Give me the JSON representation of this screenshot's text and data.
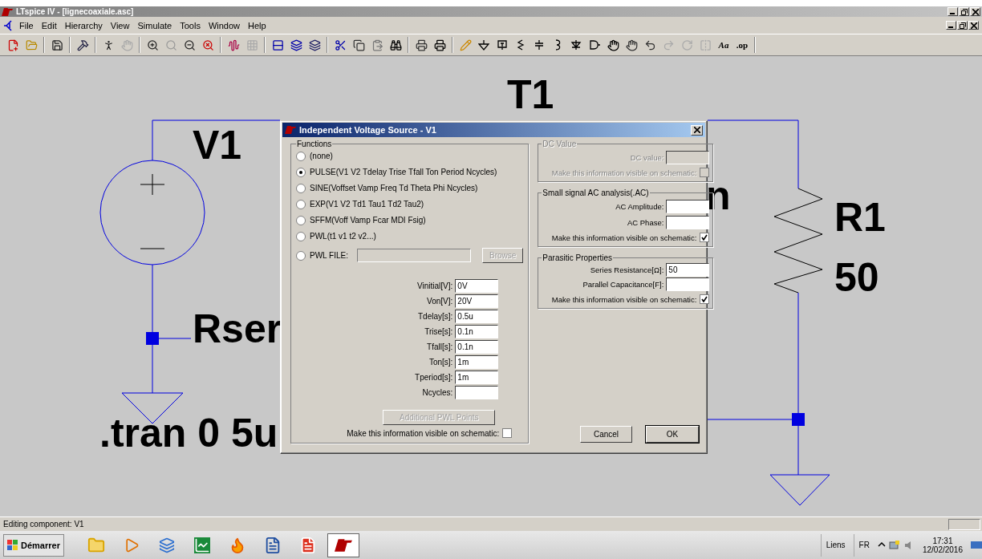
{
  "window": {
    "title": "LTspice IV - [lignecoaxiale.asc]"
  },
  "menu": [
    "File",
    "Edit",
    "Hierarchy",
    "View",
    "Simulate",
    "Tools",
    "Window",
    "Help"
  ],
  "toolbar": {
    "text_buttons": [
      "Aa",
      ".op"
    ]
  },
  "schematic": {
    "labels": [
      "T1",
      "V1",
      "n",
      "R1",
      "50",
      "Rser",
      ".tran 0 5u"
    ]
  },
  "dialog": {
    "title": "Independent Voltage Source - V1",
    "functions": {
      "title": "Functions",
      "options": [
        {
          "label": "(none)",
          "selected": false
        },
        {
          "label": "PULSE(V1 V2 Tdelay Trise Tfall Ton Period Ncycles)",
          "selected": true
        },
        {
          "label": "SINE(Voffset Vamp Freq Td Theta Phi Ncycles)",
          "selected": false
        },
        {
          "label": "EXP(V1 V2 Td1 Tau1 Td2 Tau2)",
          "selected": false
        },
        {
          "label": "SFFM(Voff Vamp Fcar MDI Fsig)",
          "selected": false
        },
        {
          "label": "PWL(t1 v1 t2 v2...)",
          "selected": false
        },
        {
          "label": "PWL FILE:",
          "selected": false
        }
      ],
      "browse": {
        "label": "Browse",
        "disabled": true
      },
      "parameters": [
        {
          "label": "Vinitial[V]:",
          "value": "0V"
        },
        {
          "label": "Von[V]:",
          "value": "20V"
        },
        {
          "label": "Tdelay[s]:",
          "value": "0.5u"
        },
        {
          "label": "Trise[s]:",
          "value": "0.1n"
        },
        {
          "label": "Tfall[s]:",
          "value": "0.1n"
        },
        {
          "label": "Ton[s]:",
          "value": "1m"
        },
        {
          "label": "Tperiod[s]:",
          "value": "1m"
        },
        {
          "label": "Ncycles:"
        }
      ],
      "additional_button": {
        "label": "Additional PWL Points",
        "disabled": true
      },
      "visible": {
        "label": "Make this information visible on schematic:",
        "checked": false
      }
    },
    "groups": [
      {
        "title": "DC Value",
        "disabled": true,
        "fields": [
          {
            "label": "DC value:"
          }
        ],
        "visible": {
          "label": "Make this information visible on schematic:",
          "checked": false
        }
      },
      {
        "title": "Small signal AC analysis(.AC)",
        "disabled": false,
        "fields": [
          {
            "label": "AC Amplitude:"
          },
          {
            "label": "AC Phase:"
          }
        ],
        "visible": {
          "label": "Make this information visible on schematic:",
          "checked": true
        }
      },
      {
        "title": "Parasitic Properties",
        "disabled": false,
        "fields": [
          {
            "label": "Series Resistance[Ω]:",
            "value": "50"
          },
          {
            "label": "Parallel Capacitance[F]:"
          }
        ],
        "visible": {
          "label": "Make this information visible on schematic:",
          "checked": true
        }
      }
    ],
    "buttons": [
      {
        "label": "Cancel",
        "default": false
      },
      {
        "label": "OK",
        "default": true
      }
    ]
  },
  "status_bar": {
    "text": "Editing component: V1"
  },
  "taskbar": {
    "start": "Démarrer",
    "tray": [
      "Liens",
      "FR"
    ],
    "time": "17:31",
    "date": "12/02/2016"
  }
}
